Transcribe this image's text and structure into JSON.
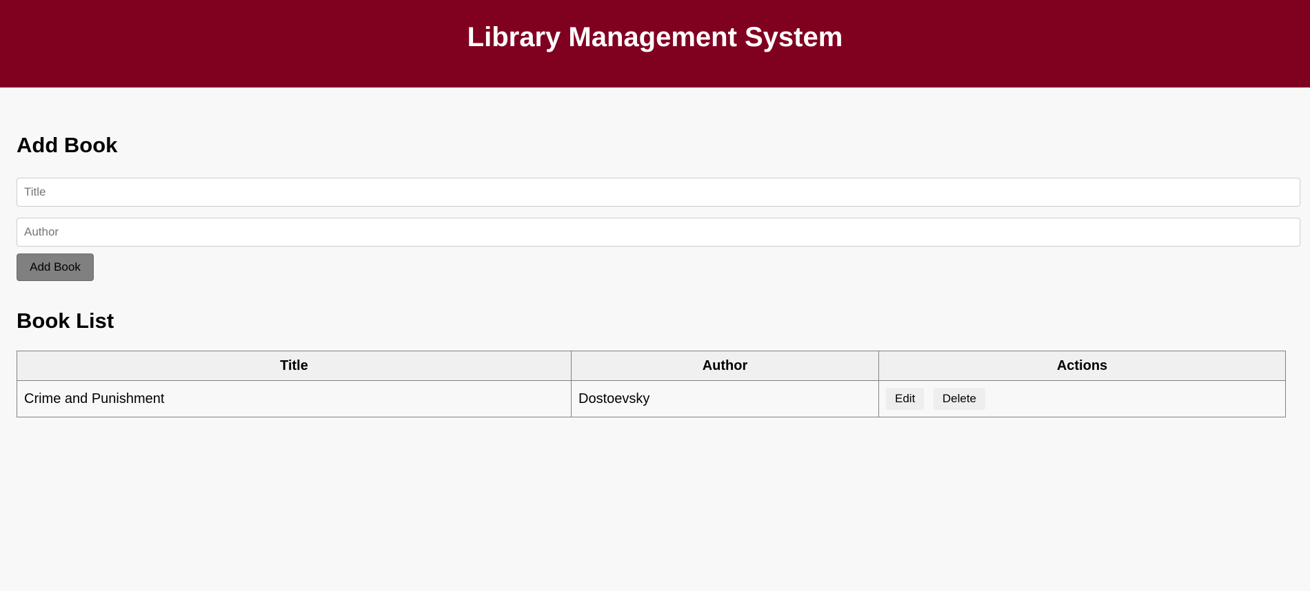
{
  "header": {
    "title": "Library Management System"
  },
  "colors": {
    "header_background": "#800020",
    "page_background": "#f8f8f8",
    "add_button_background": "#808080",
    "table_header_background": "#f0f0f0"
  },
  "add_book": {
    "heading": "Add Book",
    "title_field": {
      "placeholder": "Title",
      "value": ""
    },
    "author_field": {
      "placeholder": "Author",
      "value": ""
    },
    "submit_label": "Add Book"
  },
  "book_list": {
    "heading": "Book List",
    "columns": [
      "Title",
      "Author",
      "Actions"
    ],
    "rows": [
      {
        "title": "Crime and Punishment",
        "author": "Dostoevsky",
        "edit_label": "Edit",
        "delete_label": "Delete"
      }
    ]
  }
}
